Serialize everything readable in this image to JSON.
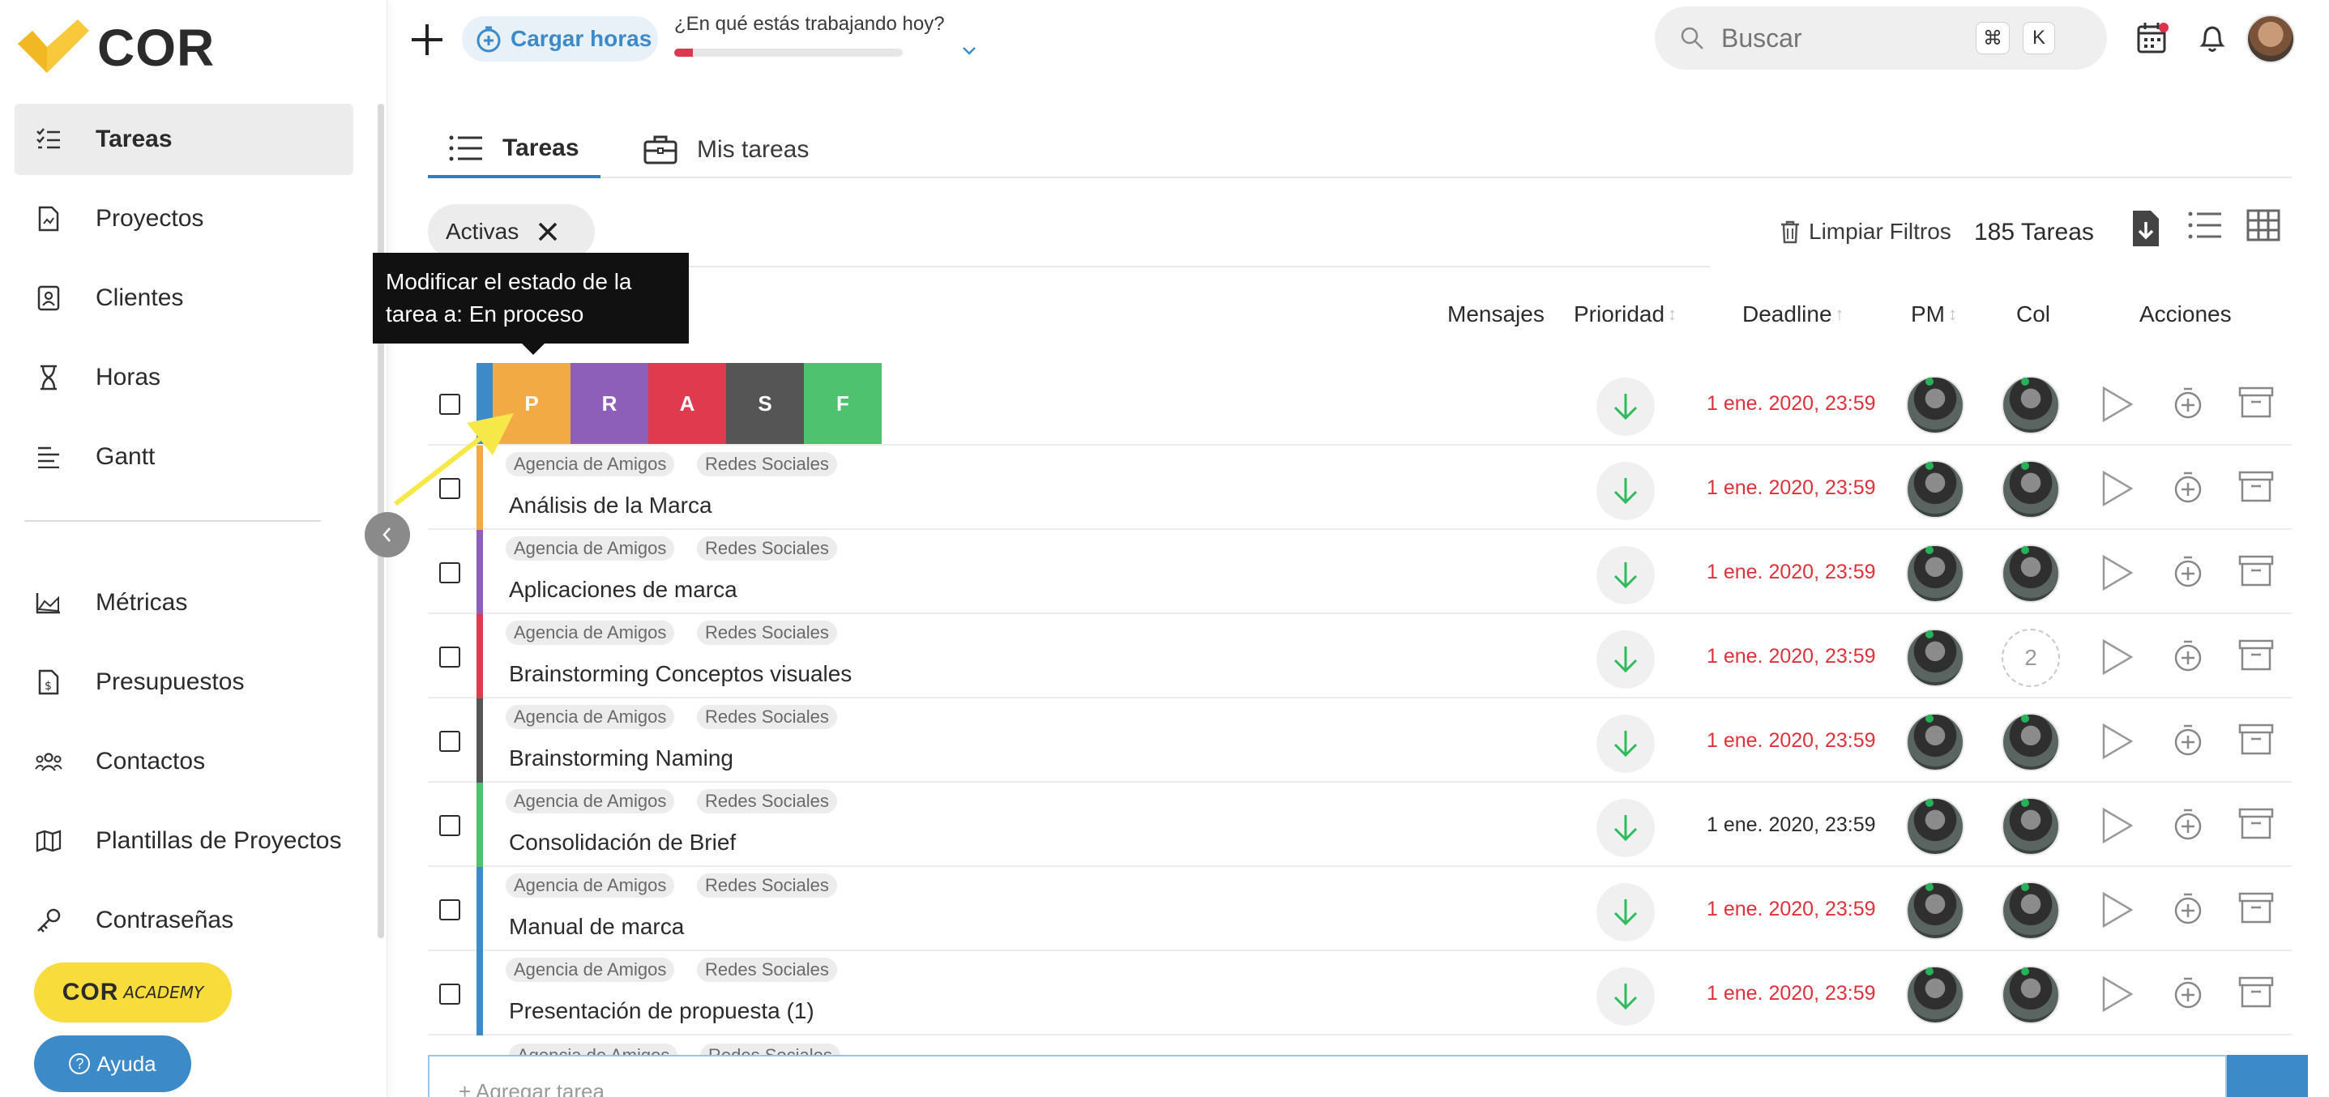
{
  "brand": {
    "name": "COR",
    "logo_color": "#f7c93b"
  },
  "sidebar": {
    "items": [
      {
        "label": "Tareas",
        "icon": "tasks-list-icon",
        "active": true
      },
      {
        "label": "Proyectos",
        "icon": "project-doc-icon"
      },
      {
        "label": "Clientes",
        "icon": "client-card-icon"
      },
      {
        "label": "Horas",
        "icon": "hourglass-icon"
      },
      {
        "label": "Gantt",
        "icon": "gantt-lines-icon"
      },
      {
        "label": "Métricas",
        "icon": "chart-area-icon"
      },
      {
        "label": "Presupuestos",
        "icon": "budget-doc-icon"
      },
      {
        "label": "Contactos",
        "icon": "contacts-group-icon"
      },
      {
        "label": "Plantillas de Proyectos",
        "icon": "map-template-icon"
      },
      {
        "label": "Contraseñas",
        "icon": "key-icon"
      }
    ],
    "academy": {
      "main": "COR",
      "sub": "ACADEMY"
    },
    "help_label": "Ayuda"
  },
  "topbar": {
    "cargar_label": "Cargar horas",
    "working_question": "¿En qué estás trabajando hoy?",
    "progress": 0.08,
    "search_placeholder": "Buscar",
    "shortcut_cmd": "⌘",
    "shortcut_key": "K"
  },
  "tabs": [
    {
      "label": "Tareas",
      "icon": "list-icon",
      "active": true
    },
    {
      "label": "Mis tareas",
      "icon": "briefcase-icon"
    }
  ],
  "filters": {
    "chip_label": "Activas",
    "clear_label": "Limpiar Filtros",
    "count_label": "185 Tareas"
  },
  "tooltip": "Modificar el estado de la tarea a: En proceso",
  "columns": {
    "mensajes": "Mensajes",
    "prioridad": "Prioridad",
    "deadline": "Deadline",
    "pm": "PM",
    "col": "Col",
    "acciones": "Acciones"
  },
  "status_options": [
    {
      "letter": "P",
      "color": "#f2ab44",
      "meaning": "En proceso"
    },
    {
      "letter": "R",
      "color": "#8e5fb9"
    },
    {
      "letter": "A",
      "color": "#df3a4e"
    },
    {
      "letter": "S",
      "color": "#555555"
    },
    {
      "letter": "F",
      "color": "#4fc270"
    }
  ],
  "first_row": {
    "deadline": "1 ene. 2020, 23:59",
    "deadline_overdue": true
  },
  "tasks": [
    {
      "client": "Agencia de Amigos",
      "project": "Redes Sociales",
      "name": "Análisis de la Marca",
      "deadline": "1 ene. 2020, 23:59",
      "overdue": true,
      "status_color": "#f2ab44"
    },
    {
      "client": "Agencia de Amigos",
      "project": "Redes Sociales",
      "name": "Aplicaciones de marca",
      "deadline": "1 ene. 2020, 23:59",
      "overdue": true,
      "status_color": "#8e5fb9"
    },
    {
      "client": "Agencia de Amigos",
      "project": "Redes Sociales",
      "name": "Brainstorming Conceptos visuales",
      "deadline": "1 ene. 2020, 23:59",
      "overdue": true,
      "status_color": "#df3a4e",
      "collaborators": "2"
    },
    {
      "client": "Agencia de Amigos",
      "project": "Redes Sociales",
      "name": "Brainstorming Naming",
      "deadline": "1 ene. 2020, 23:59",
      "overdue": true,
      "status_color": "#555555"
    },
    {
      "client": "Agencia de Amigos",
      "project": "Redes Sociales",
      "name": "Consolidación de Brief",
      "deadline": "1 ene. 2020, 23:59",
      "overdue": false,
      "status_color": "#4fc270"
    },
    {
      "client": "Agencia de Amigos",
      "project": "Redes Sociales",
      "name": "Manual de marca",
      "deadline": "1 ene. 2020, 23:59",
      "overdue": true,
      "status_color": "#3d8ac9"
    },
    {
      "client": "Agencia de Amigos",
      "project": "Redes Sociales",
      "name": "Presentación de propuesta (1)",
      "deadline": "1 ene. 2020, 23:59",
      "overdue": true,
      "status_color": "#3d8ac9"
    }
  ],
  "partial_row": {
    "client": "Agencia de Amigos",
    "project": "Redes Sociales"
  },
  "add_task_placeholder": "+ Agregar tarea"
}
